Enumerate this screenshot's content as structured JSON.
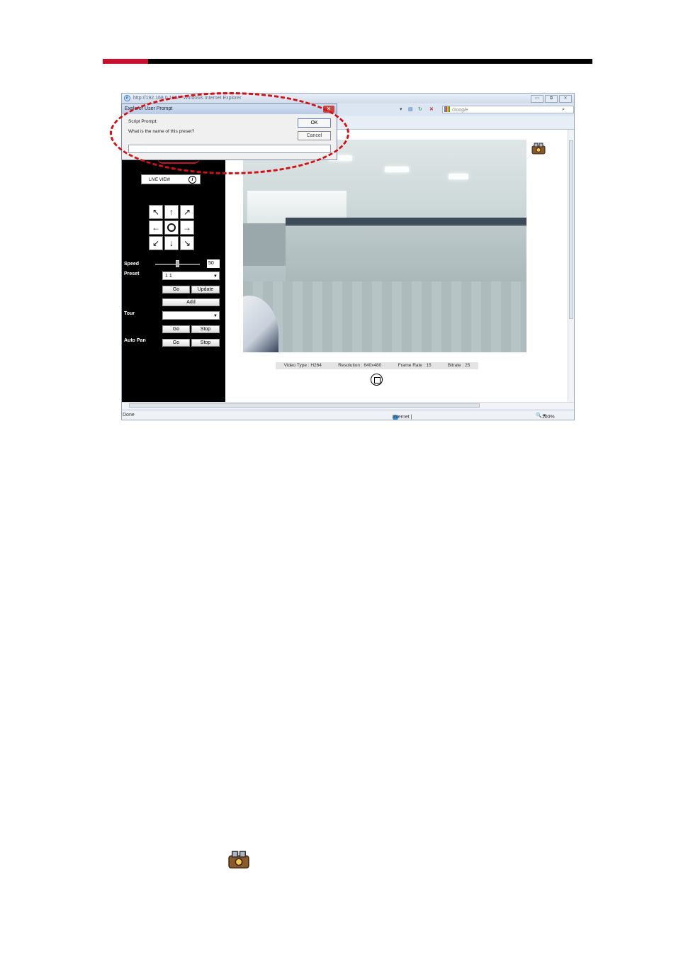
{
  "window": {
    "title": "http://192.168.0.100/ - Windows Internet Explorer",
    "search_placeholder": "Google",
    "status_left": "Done",
    "status_zone": "Internet | Protected Mode: Off",
    "zoom": "100%"
  },
  "dialog": {
    "title": "Explorer User Prompt",
    "line1": "Script Prompt:",
    "line2": "What is the name of this preset?",
    "ok_label": "OK",
    "cancel_label": "Cancel",
    "input_value": ""
  },
  "sidebar": {
    "live_view_label": "LIVE VIEW",
    "speed_label": "Speed",
    "speed_value": "50",
    "preset_label": "Preset",
    "preset_value": "1 1",
    "preset_go": "Go",
    "preset_update": "Update",
    "preset_add": "Add",
    "tour_label": "Tour",
    "tour_value": "",
    "tour_go": "Go",
    "tour_stop": "Stop",
    "autopan_label": "Auto Pan",
    "autopan_go": "Go",
    "autopan_stop": "Stop"
  },
  "video_status": {
    "type": "Video Type : H264",
    "resolution": "Resolution : 640x480",
    "frame_rate": "Frame Rate : 15",
    "bitrate": "Bitrate : 25"
  },
  "colors": {
    "brand_red": "#c8102e",
    "highlight_red": "#d40f14"
  },
  "icons": [
    "ie-icon",
    "camera-setup-icon",
    "fullscreen-icon",
    "globe-icon"
  ]
}
